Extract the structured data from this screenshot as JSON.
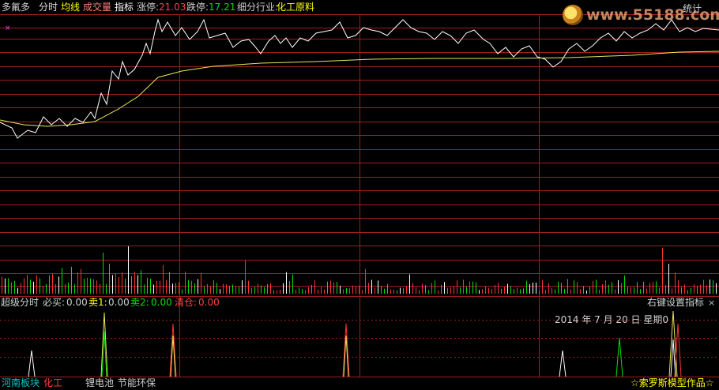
{
  "header": {
    "stock_name": "多氟多",
    "tab_fenshi": "分时",
    "tab_junxian": "均线",
    "tab_chengjiaoliang": "成交量",
    "tab_zhibiao": "指标",
    "zhangting_label": "涨停:",
    "zhangting_value": "21.03",
    "dieting_label": "跌停:",
    "dieting_value": "17.21",
    "industry_label": "细分行业:",
    "industry_value": "化工原料",
    "stats_label": "统计",
    "watermark": "www.55188.com"
  },
  "indicator": {
    "title": "超级分时",
    "buy_label": "必买:",
    "buy_value": "0.00",
    "sell1_label": "卖1:",
    "sell1_value": "0.00",
    "sell2_label": "卖2:",
    "sell2_value": "0.00",
    "clear_label": "清仓:",
    "clear_value": "0.00",
    "right_click": "右键设置指标",
    "close": "×",
    "date": "2014 年 7 月 20 日 星期0"
  },
  "footer": {
    "region": "河南板块",
    "sector": "化工",
    "concept1": "锂电池",
    "concept2": "节能环保",
    "credit": "☆索罗斯模型作品☆"
  },
  "colors": {
    "up": "#ff3232",
    "down": "#00e000",
    "grid": "#a01e1e",
    "price_line": "#ffffff",
    "avg_line": "#e6e65a",
    "label_yellow": "#ffff00",
    "label_cyan": "#00c8c8"
  }
}
